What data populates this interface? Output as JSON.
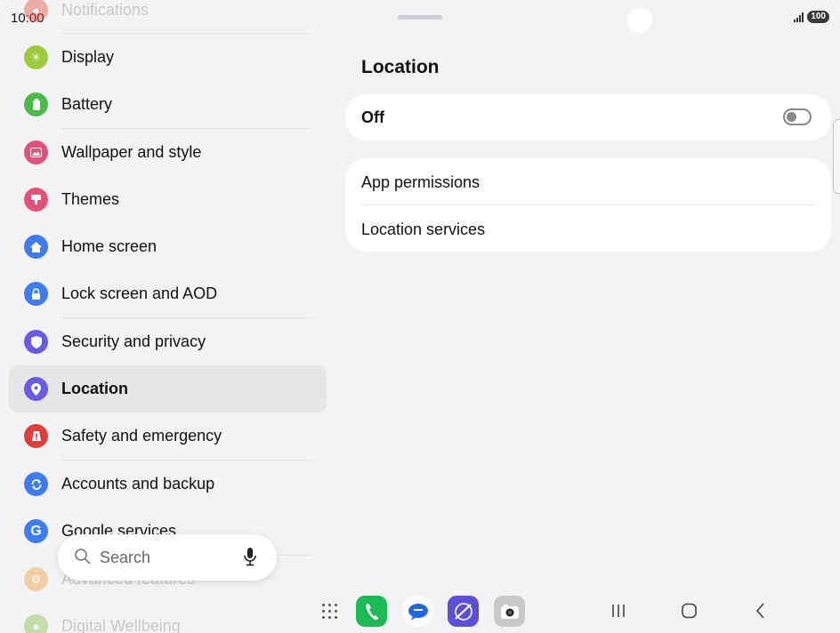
{
  "status_bar": {
    "time": "10:00",
    "battery": "100"
  },
  "sidebar": {
    "items": [
      {
        "label": "Notifications",
        "icon": "notifications-icon",
        "color": "#e9574c",
        "state": "faded-top"
      },
      {
        "label": "Display",
        "icon": "sun-icon",
        "color": "#9ccc3d"
      },
      {
        "label": "Battery",
        "icon": "battery-icon",
        "color": "#4cbb4c"
      },
      {
        "label": "Wallpaper and style",
        "icon": "wallpaper-icon",
        "color": "#e2517a"
      },
      {
        "label": "Themes",
        "icon": "themes-icon",
        "color": "#e2517a"
      },
      {
        "label": "Home screen",
        "icon": "home-icon",
        "color": "#3f7cf4"
      },
      {
        "label": "Lock screen and AOD",
        "icon": "lock-icon",
        "color": "#3f7cf4"
      },
      {
        "label": "Security and privacy",
        "icon": "shield-icon",
        "color": "#6a5be5"
      },
      {
        "label": "Location",
        "icon": "location-pin-icon",
        "color": "#6a5be5",
        "state": "active"
      },
      {
        "label": "Safety and emergency",
        "icon": "emergency-icon",
        "color": "#de3f3a"
      },
      {
        "label": "Accounts and backup",
        "icon": "sync-icon",
        "color": "#3f7cf4"
      },
      {
        "label": "Google services",
        "icon": "google-icon",
        "color": "#3f7cf4"
      },
      {
        "label": "Advanced features",
        "icon": "gear-plus-icon",
        "color": "#f2a540",
        "state": "faded"
      },
      {
        "label": "Digital Wellbeing",
        "icon": "wellbeing-icon",
        "color": "#8cc34a",
        "state": "faded"
      }
    ]
  },
  "search": {
    "placeholder": "Search"
  },
  "main": {
    "title": "Location",
    "toggle_label": "Off",
    "toggle_on": false,
    "rows": [
      "App permissions",
      "Location services"
    ]
  },
  "dock": {
    "apps": [
      {
        "name": "phone-app-icon",
        "color": "#1db954"
      },
      {
        "name": "messages-app-icon",
        "color": "#2166e8"
      },
      {
        "name": "internet-app-icon",
        "color": "#5b4fd8"
      },
      {
        "name": "camera-app-icon",
        "color": "#c9c9cc"
      }
    ]
  }
}
